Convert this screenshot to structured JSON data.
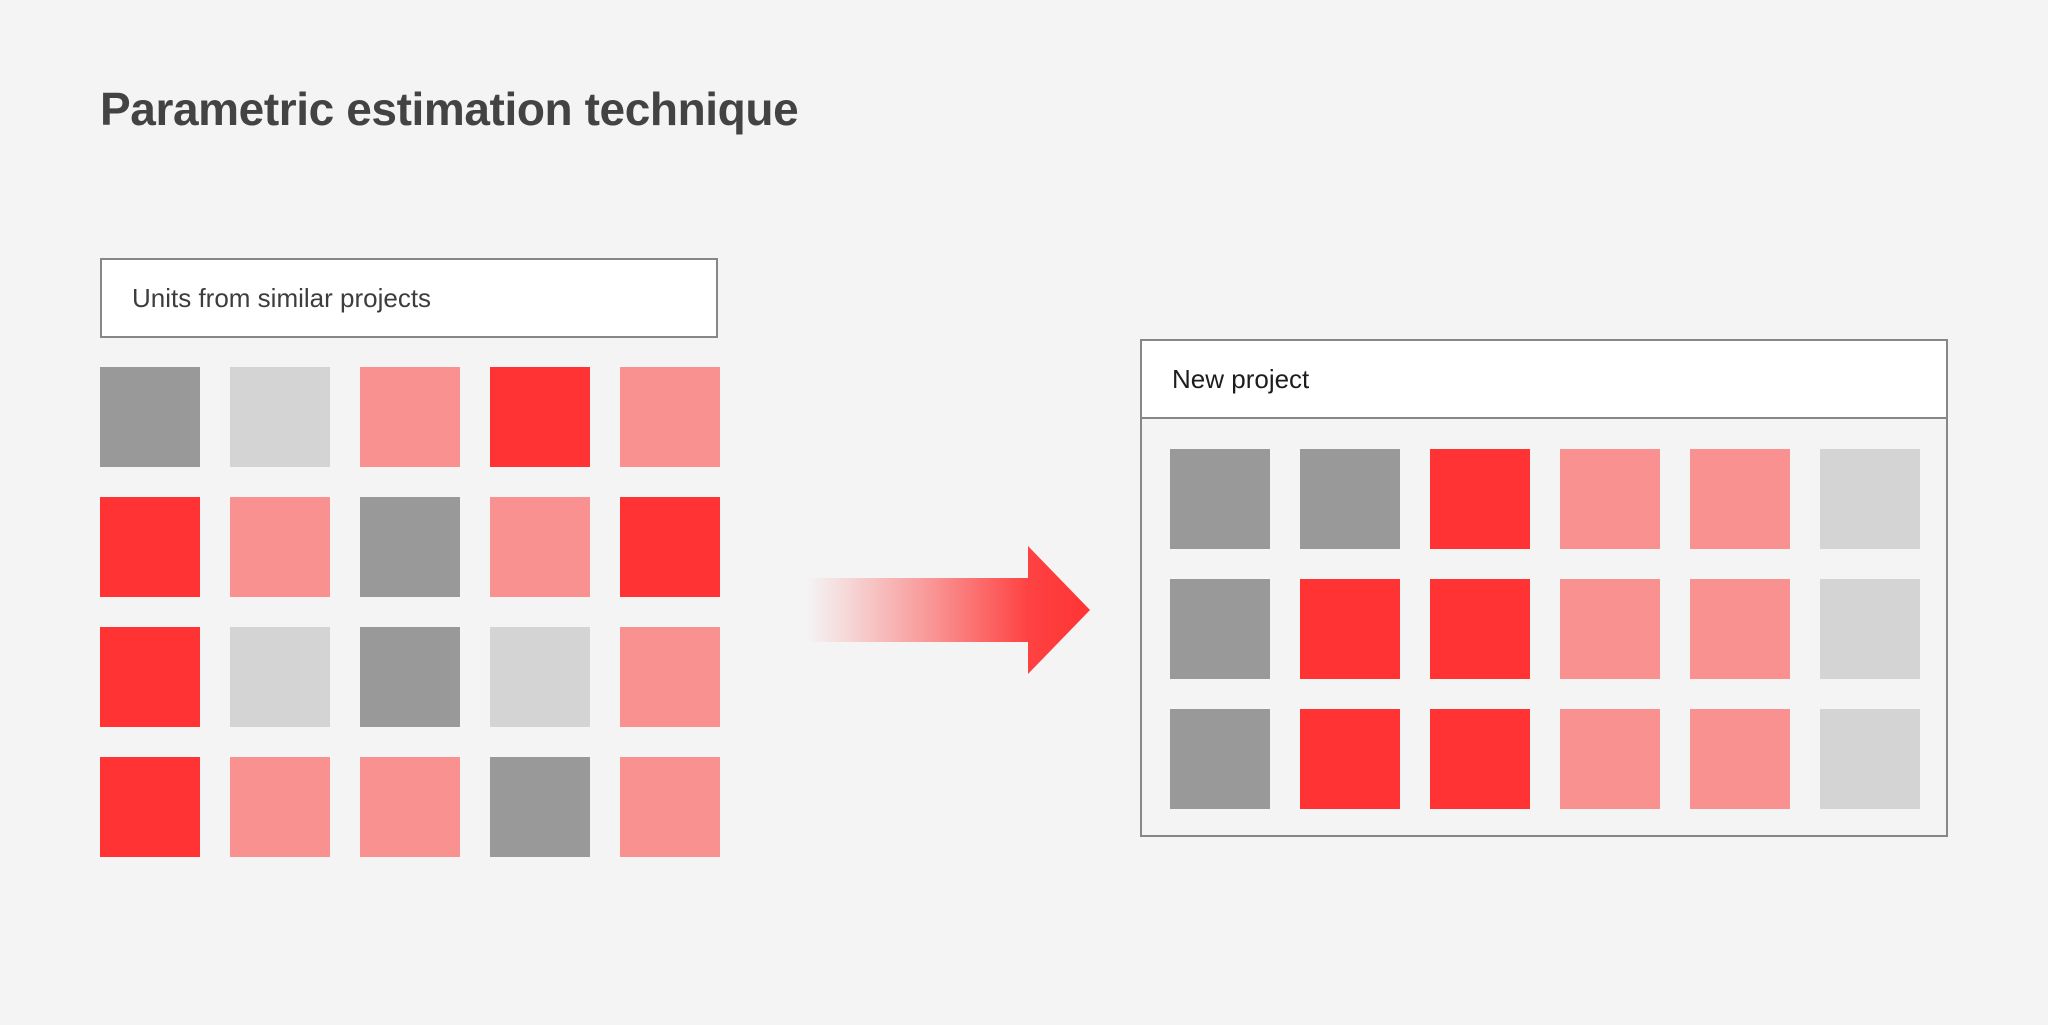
{
  "page": {
    "title": "Parametric estimation technique",
    "background_color": "#f4f4f4",
    "title_color": "#434343"
  },
  "palette": {
    "gray": "#999999",
    "light_gray": "#d4d4d4",
    "pink": "#f99191",
    "red": "#ff3333",
    "border": "#878787",
    "panel_bg": "#ffffff"
  },
  "left_panel": {
    "header_label": "Units from similar projects",
    "grid": {
      "columns": 5,
      "rows": 4,
      "cells": [
        [
          "gray",
          "light_gray",
          "pink",
          "red",
          "pink"
        ],
        [
          "red",
          "pink",
          "gray",
          "pink",
          "red"
        ],
        [
          "red",
          "light_gray",
          "gray",
          "light_gray",
          "pink"
        ],
        [
          "red",
          "pink",
          "pink",
          "gray",
          "pink"
        ]
      ]
    }
  },
  "arrow": {
    "name": "right-arrow",
    "direction": "right",
    "gradient_from": "#f4f4f4",
    "gradient_to": "#ff3333"
  },
  "right_panel": {
    "header_label": "New project",
    "grid": {
      "columns": 6,
      "rows": 3,
      "cells": [
        [
          "gray",
          "gray",
          "red",
          "pink",
          "pink",
          "light_gray"
        ],
        [
          "gray",
          "red",
          "red",
          "pink",
          "pink",
          "light_gray"
        ],
        [
          "gray",
          "red",
          "red",
          "pink",
          "pink",
          "light_gray"
        ]
      ]
    }
  }
}
